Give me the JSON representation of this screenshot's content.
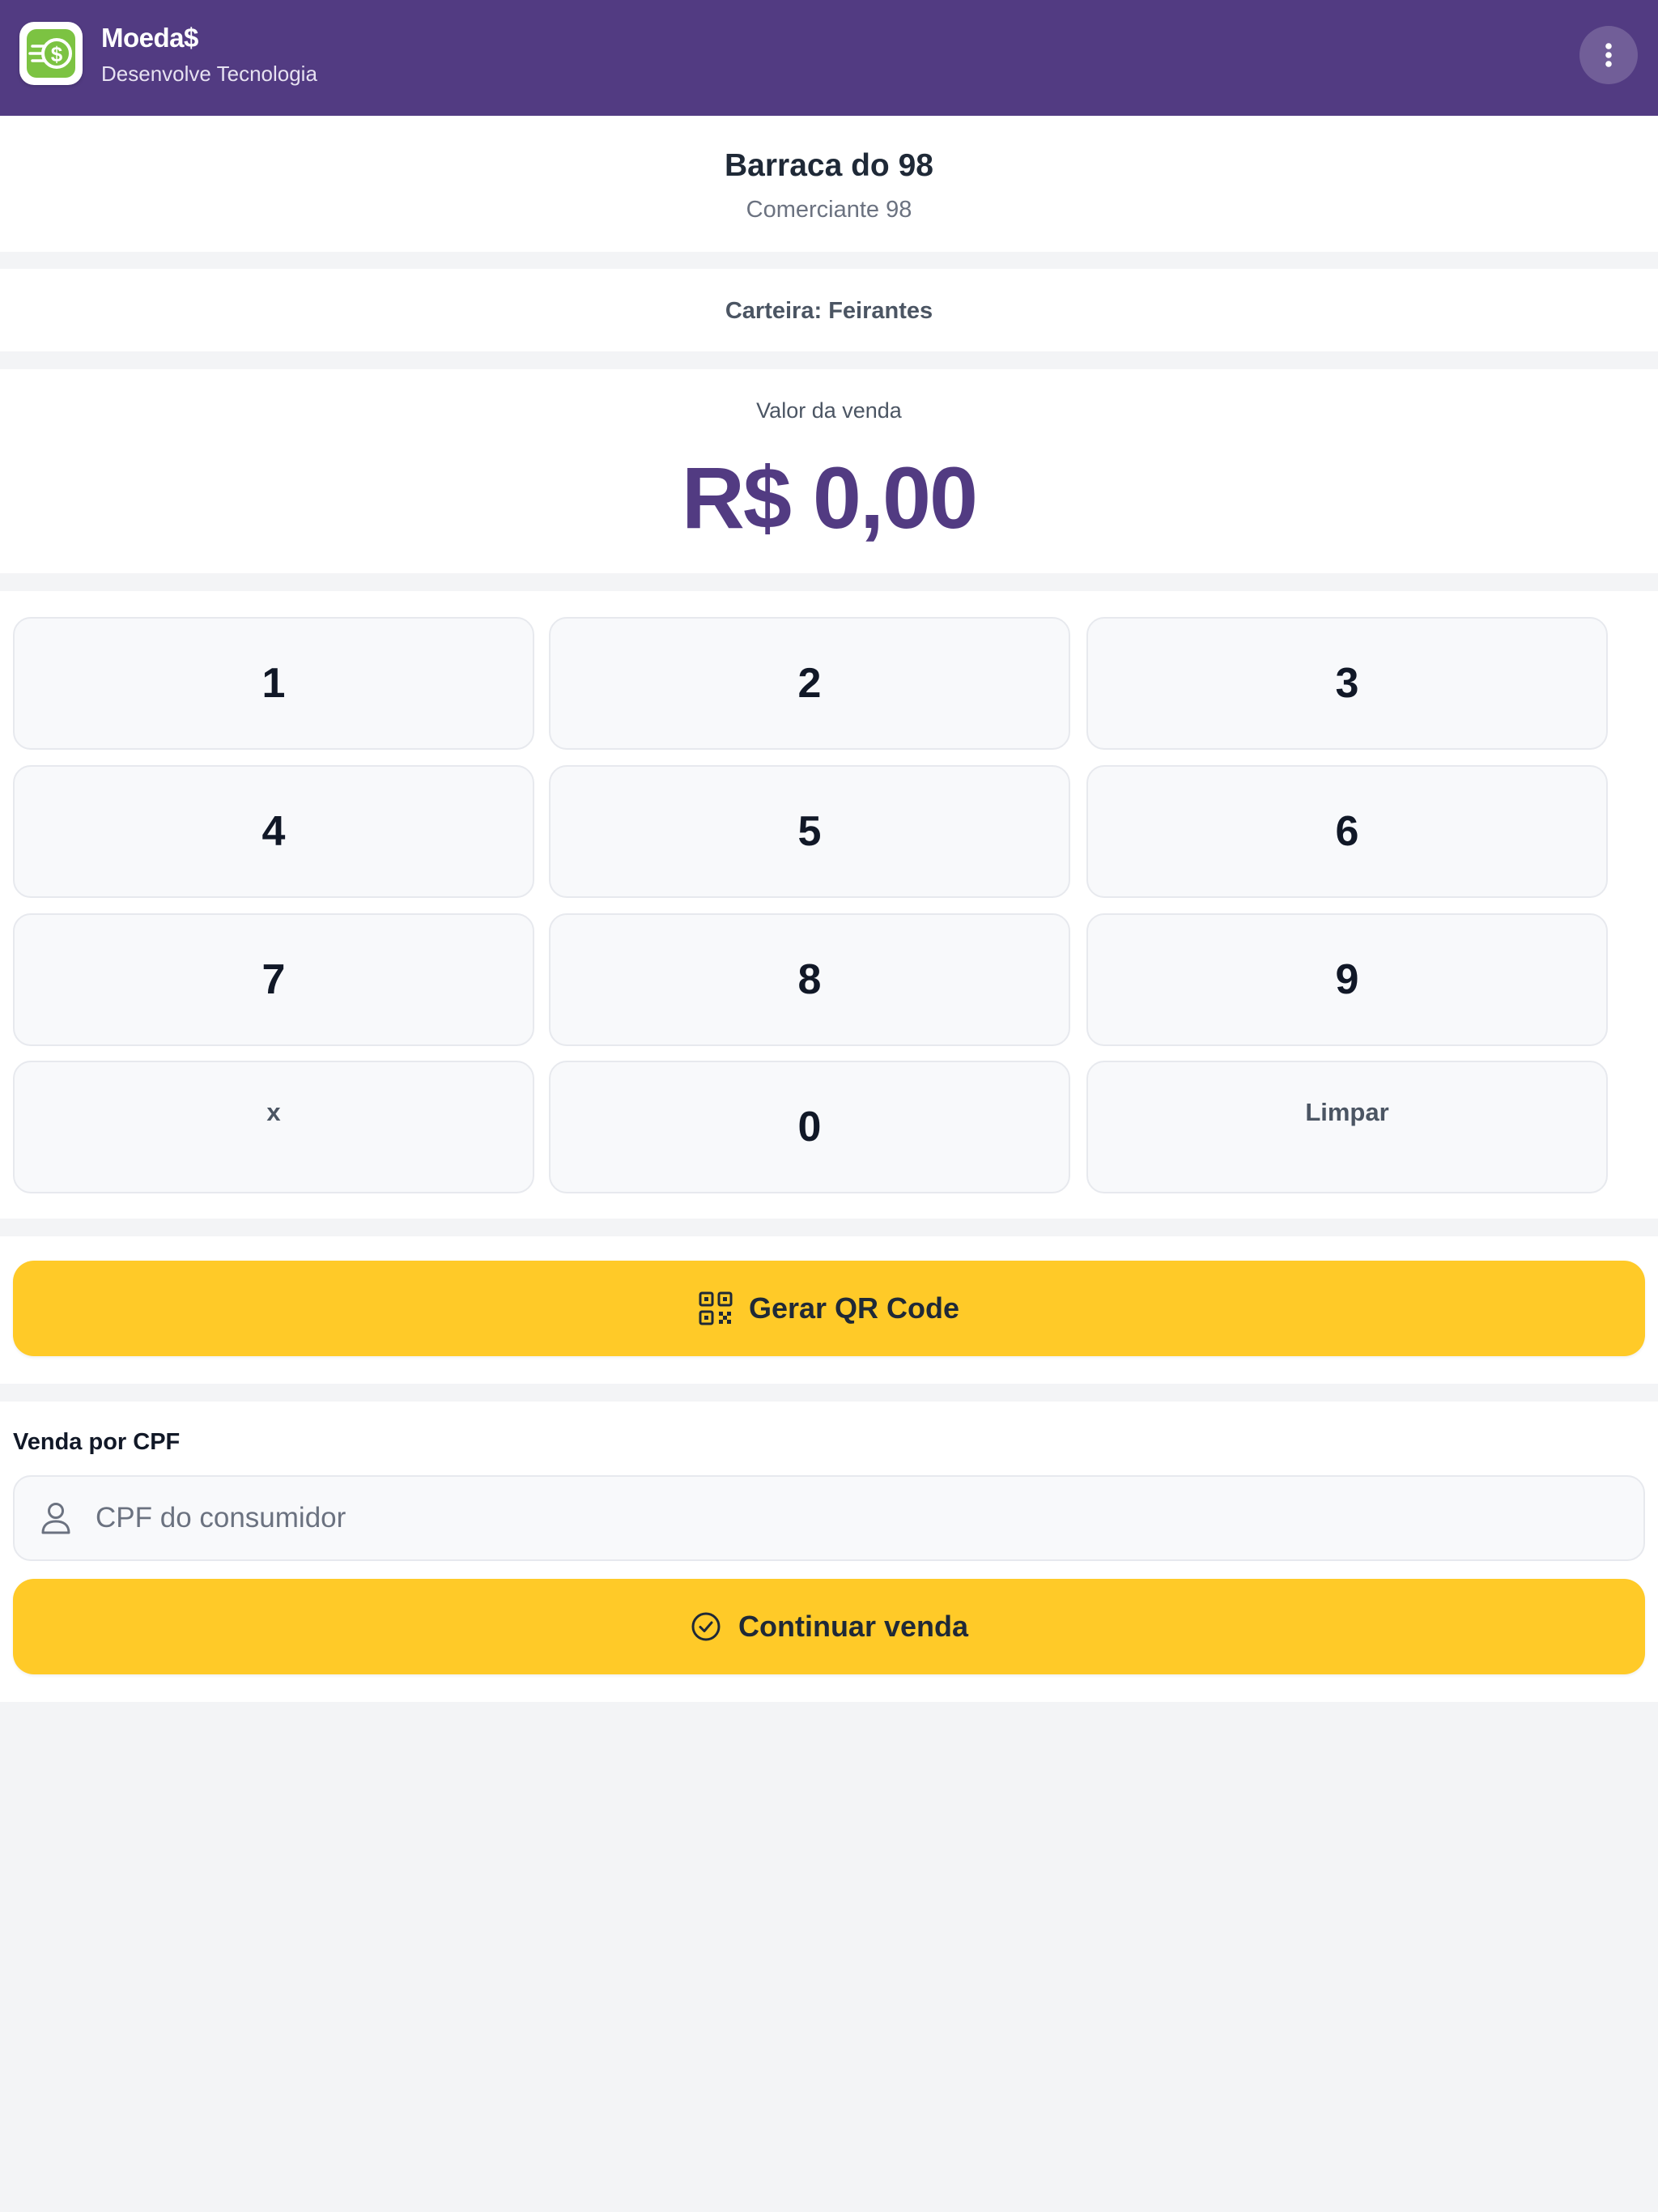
{
  "header": {
    "app_name": "Moeda$",
    "subtitle": "Desenvolve Tecnologia",
    "logo_icon": "dollar-coin-icon",
    "menu_icon": "more-vertical-icon"
  },
  "merchant": {
    "name": "Barraca do 98",
    "subtitle": "Comerciante 98"
  },
  "wallet": {
    "label": "Carteira: Feirantes"
  },
  "sale": {
    "label": "Valor da venda",
    "amount": "R$ 0,00"
  },
  "keypad": {
    "keys": [
      "1",
      "2",
      "3",
      "4",
      "5",
      "6",
      "7",
      "8",
      "9",
      "x",
      "0",
      "Limpar"
    ]
  },
  "qr_button": {
    "label": "Gerar QR Code",
    "icon": "qr-code-icon"
  },
  "cpf_sale": {
    "section_label": "Venda por CPF",
    "input_value": "",
    "placeholder": "CPF do consumidor",
    "input_icon": "user-icon",
    "continue_label": "Continuar venda",
    "continue_icon": "check-circle-icon"
  },
  "colors": {
    "header_bg": "#523b82",
    "accent_purple": "#523b82",
    "button_yellow": "#ffca28",
    "logo_green": "#7cc342",
    "page_bg": "#f3f4f6"
  }
}
